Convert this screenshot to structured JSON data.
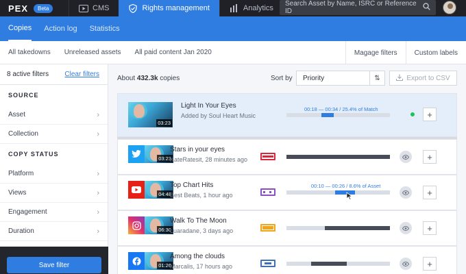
{
  "topnav": {
    "logo": "PEX",
    "beta": "Beta",
    "tabs": [
      {
        "label": "CMS",
        "active": false
      },
      {
        "label": "Rights management",
        "active": true
      },
      {
        "label": "Analytics",
        "active": false
      }
    ],
    "search_placeholder": "Search Asset by Name, ISRC or Reference ID"
  },
  "subnav": {
    "items": [
      "Copies",
      "Action log",
      "Statistics"
    ],
    "active": "Copies"
  },
  "filterbar": {
    "presets": [
      "All takedowns",
      "Unreleased assets",
      "All paid content Jan 2020"
    ],
    "manage_filters": "Magage filters",
    "custom_labels": "Custom labels"
  },
  "sidebar": {
    "active_filters": "8 active filters",
    "clear_filters": "Clear filters",
    "source_header": "SOURCE",
    "source_items": [
      "Asset",
      "Collection"
    ],
    "status_header": "COPY STATUS",
    "status_items": [
      "Platform",
      "Views",
      "Engagement",
      "Duration"
    ],
    "save_filter": "Save filter"
  },
  "results": {
    "count_prefix": "About",
    "count": "432.3k",
    "count_suffix": "copies",
    "sort_label": "Sort by",
    "sort_value": "Priority",
    "export": "Export to CSV"
  },
  "featured": {
    "title": "Light In Your Eyes",
    "subtitle": "Added by Soul Heart Music",
    "duration": "03:23",
    "match_label": "00:18 — 00:34 / 25.4% of Match",
    "match_start": 0.0,
    "match_end": 0.17,
    "highlight_start": 0.34,
    "highlight_end": 0.46,
    "status_color": "#1ec05e"
  },
  "copies": [
    {
      "platform": "twitter-icon",
      "title": "Stars in your eyes",
      "subtitle": "KateRatesit, 28 minutes ago",
      "duration": "03:23",
      "badge_color": "#d9263a",
      "bar_start": 0.0,
      "bar_end": 1.0,
      "label": ""
    },
    {
      "platform": "youtube-icon",
      "title": "Top Chart Hits",
      "subtitle": "Best Beats, 1 hour ago",
      "duration": "04:48",
      "badge_color": "#8a4fc4",
      "bar_start": 0.47,
      "bar_end": 0.66,
      "label": "00:10 — 00:26 / 8.6% of Asset"
    },
    {
      "platform": "instagram-icon",
      "title": "Walk To The Moon",
      "subtitle": "Luaradane, 3 days ago",
      "duration": "06:30",
      "badge_color": "#f2a516",
      "bar_start": 0.37,
      "bar_end": 1.0,
      "label": ""
    },
    {
      "platform": "facebook-icon",
      "title": "Among the clouds",
      "subtitle": "Marcalis, 17 hours ago",
      "duration": "01:26",
      "badge_color": "#3f6fb8",
      "bar_start": 0.24,
      "bar_end": 0.58,
      "label": ""
    }
  ]
}
